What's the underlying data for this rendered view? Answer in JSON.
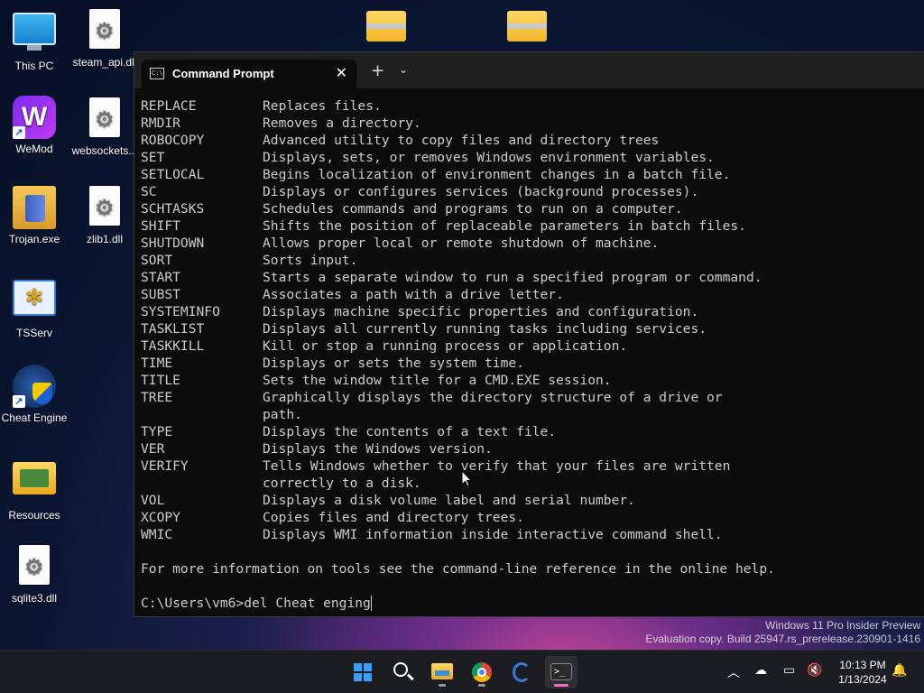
{
  "desktop": {
    "icons": [
      {
        "label": "This PC",
        "icon": "this-pc-icon"
      },
      {
        "label": "steam_api.dll",
        "icon": "dll-file-icon"
      },
      {
        "label": "WeMod",
        "icon": "wemod-icon"
      },
      {
        "label": "websockets...",
        "icon": "dll-file-icon"
      },
      {
        "label": "Trojan.exe",
        "icon": "trojan-exe-icon"
      },
      {
        "label": "zlib1.dll",
        "icon": "dll-file-icon"
      },
      {
        "label": "TSServ",
        "icon": "tsserv-icon"
      },
      {
        "label": "Cheat Engine",
        "icon": "cheat-engine-icon"
      },
      {
        "label": "Resources",
        "icon": "folder-icon"
      },
      {
        "label": "sqlite3.dll",
        "icon": "dll-file-icon"
      }
    ]
  },
  "terminal": {
    "tab_title": "Command Prompt",
    "tab_close": "✕",
    "new_tab": "+",
    "dropdown": "⌄",
    "commands": [
      {
        "cmd": "REPLACE",
        "desc": "Replaces files."
      },
      {
        "cmd": "RMDIR",
        "desc": "Removes a directory."
      },
      {
        "cmd": "ROBOCOPY",
        "desc": "Advanced utility to copy files and directory trees"
      },
      {
        "cmd": "SET",
        "desc": "Displays, sets, or removes Windows environment variables."
      },
      {
        "cmd": "SETLOCAL",
        "desc": "Begins localization of environment changes in a batch file."
      },
      {
        "cmd": "SC",
        "desc": "Displays or configures services (background processes)."
      },
      {
        "cmd": "SCHTASKS",
        "desc": "Schedules commands and programs to run on a computer."
      },
      {
        "cmd": "SHIFT",
        "desc": "Shifts the position of replaceable parameters in batch files."
      },
      {
        "cmd": "SHUTDOWN",
        "desc": "Allows proper local or remote shutdown of machine."
      },
      {
        "cmd": "SORT",
        "desc": "Sorts input."
      },
      {
        "cmd": "START",
        "desc": "Starts a separate window to run a specified program or command."
      },
      {
        "cmd": "SUBST",
        "desc": "Associates a path with a drive letter."
      },
      {
        "cmd": "SYSTEMINFO",
        "desc": "Displays machine specific properties and configuration."
      },
      {
        "cmd": "TASKLIST",
        "desc": "Displays all currently running tasks including services."
      },
      {
        "cmd": "TASKKILL",
        "desc": "Kill or stop a running process or application."
      },
      {
        "cmd": "TIME",
        "desc": "Displays or sets the system time."
      },
      {
        "cmd": "TITLE",
        "desc": "Sets the window title for a CMD.EXE session."
      },
      {
        "cmd": "TREE",
        "desc": "Graphically displays the directory structure of a drive or"
      },
      {
        "cmd": "",
        "desc": "path."
      },
      {
        "cmd": "TYPE",
        "desc": "Displays the contents of a text file."
      },
      {
        "cmd": "VER",
        "desc": "Displays the Windows version."
      },
      {
        "cmd": "VERIFY",
        "desc": "Tells Windows whether to verify that your files are written"
      },
      {
        "cmd": "",
        "desc": "correctly to a disk."
      },
      {
        "cmd": "VOL",
        "desc": "Displays a disk volume label and serial number."
      },
      {
        "cmd": "XCOPY",
        "desc": "Copies files and directory trees."
      },
      {
        "cmd": "WMIC",
        "desc": "Displays WMI information inside interactive command shell."
      }
    ],
    "footer_help": "For more information on tools see the command-line reference in the online help.",
    "prompt": "C:\\Users\\vm6>",
    "input_value": "del Cheat enging"
  },
  "watermark": {
    "line1": "Windows 11 Pro Insider Preview",
    "line2": "Evaluation copy. Build 25947.rs_prerelease.230901-1416"
  },
  "taskbar": {
    "apps": [
      "start-icon",
      "search-icon",
      "file-explorer-icon",
      "chrome-icon",
      "cheat-engine-icon",
      "terminal-icon"
    ],
    "clock_time": "10:13 PM",
    "clock_date": "1/13/2024"
  }
}
